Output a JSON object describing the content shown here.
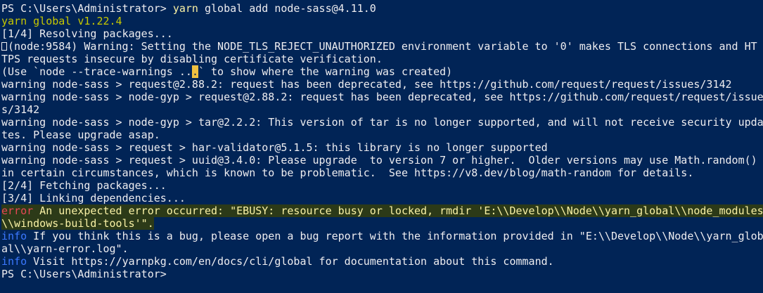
{
  "colors": {
    "background": "#012456",
    "foreground": "#eeedf0",
    "command": "#f9f1a5",
    "yarn_version": "#c8c800",
    "error": "#e74856",
    "info": "#3b78ff",
    "error_highlight": "#2c3a18"
  },
  "icons": {
    "missing_glyph": "box-glyph-icon"
  },
  "lines": {
    "l1": {
      "prompt": "PS C:\\Users\\Administrator> ",
      "cmd": "yarn",
      "args": " global add node-sass@4.11.0"
    },
    "l2": "yarn global v1.22.4",
    "l3": "[1/4] Resolving packages...",
    "l4": "(node:9584) Warning: Setting the NODE_TLS_REJECT_UNAUTHORIZED environment variable to '0' makes TLS connections and HT",
    "l5": "TPS requests insecure by disabling certificate verification.",
    "l6": {
      "a": "(Use `node --trace-warnings ..",
      "b": ".",
      "c": "` to show where the warning was created)"
    },
    "l7": "warning node-sass > request@2.88.2: request has been deprecated, see https://github.com/request/request/issues/3142",
    "l8": "warning node-sass > node-gyp > request@2.88.2: request has been deprecated, see https://github.com/request/request/issue",
    "l9": "s/3142",
    "l10": "warning node-sass > node-gyp > tar@2.2.2: This version of tar is no longer supported, and will not receive security upda",
    "l11": "tes. Please upgrade asap.",
    "l12": "warning node-sass > request > har-validator@5.1.5: this library is no longer supported",
    "l13": "warning node-sass > request > uuid@3.4.0: Please upgrade  to version 7 or higher.  Older versions may use Math.random()",
    "l14": "in certain circumstances, which is known to be problematic.  See https://v8.dev/blog/math-random for details.",
    "l15": "[2/4] Fetching packages...",
    "l16": "[3/4] Linking dependencies...",
    "l17": {
      "tag": "error",
      "msg": " An unexpected error occurred: \"EBUSY: resource busy or locked, rmdir 'E:\\\\Develop\\\\Node\\\\yarn_global\\\\node_modules"
    },
    "l18": "\\\\windows-build-tools'\".",
    "l19": {
      "tag": "info",
      "msg": " If you think this is a bug, please open a bug report with the information provided in \"E:\\\\Develop\\\\Node\\\\yarn_glob"
    },
    "l20": "al\\\\yarn-error.log\".",
    "l21": {
      "tag": "info",
      "msg": " Visit https://yarnpkg.com/en/docs/cli/global for documentation about this command."
    },
    "l22": "PS C:\\Users\\Administrator>"
  }
}
